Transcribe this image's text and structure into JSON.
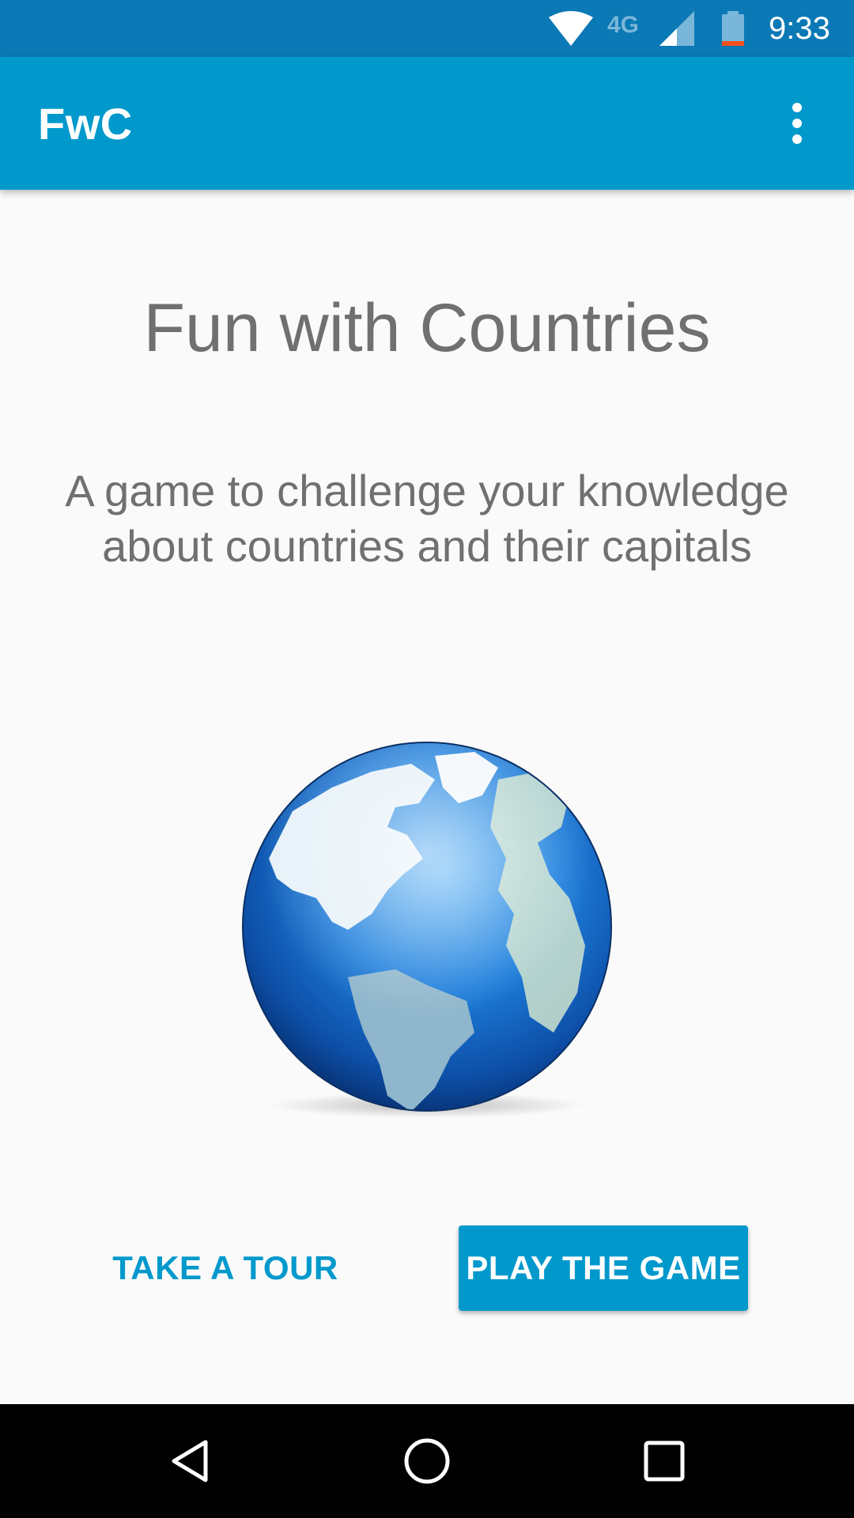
{
  "status_bar": {
    "network_type": "4G",
    "time": "9:33",
    "icons": [
      "wifi-icon",
      "cellular-signal-icon",
      "battery-icon"
    ]
  },
  "app_bar": {
    "title": "FwC",
    "menu_icon": "overflow-menu-icon"
  },
  "main": {
    "title": "Fun with Countries",
    "subtitle_line1": "A game to challenge your knowledge",
    "subtitle_line2": "about countries and their capitals",
    "image_icon": "globe-icon"
  },
  "buttons": {
    "tour_label": "TAKE A TOUR",
    "play_label": "PLAY THE GAME"
  },
  "nav_bar": {
    "icons": [
      "back-icon",
      "home-icon",
      "recents-icon"
    ]
  },
  "colors": {
    "status_bar": "#0a79b5",
    "app_bar": "#0199cc",
    "accent": "#0199cc",
    "text_secondary": "#707070",
    "background": "#fafafa",
    "nav_bar": "#000000"
  }
}
